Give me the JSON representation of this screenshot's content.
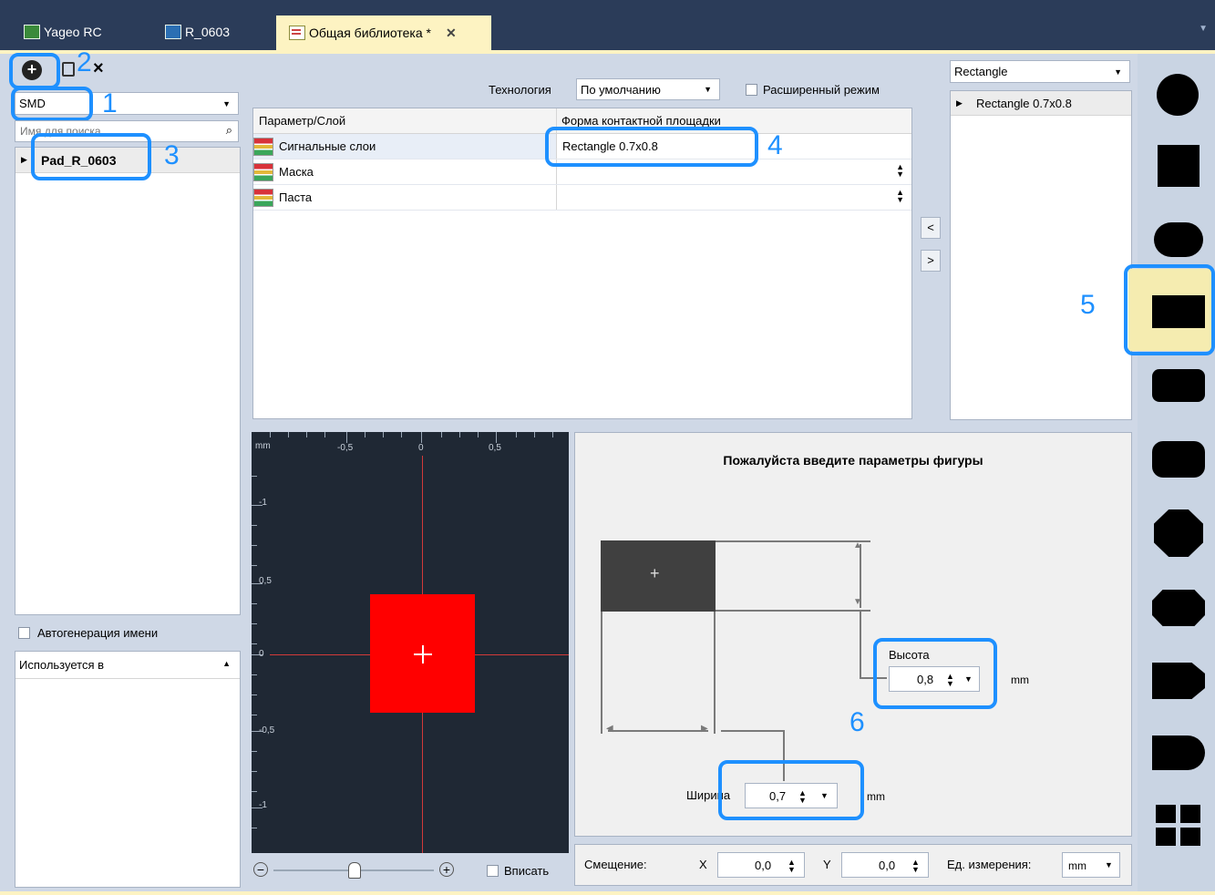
{
  "tabs": [
    {
      "label": "Yageo RC"
    },
    {
      "label": "R_0603"
    },
    {
      "label": "Общая библиотека *"
    }
  ],
  "toolbar": {
    "close_icon": "close-icon",
    "add_icon": "add-circle-icon",
    "copy_icon": "copy-icon"
  },
  "left": {
    "type_select": "SMD",
    "search_placeholder": "Имя для поиска",
    "tree_item": "Pad_R_0603",
    "autogen_label": "Автогенерация имени",
    "used_in_label": "Используется в"
  },
  "annotations": [
    "1",
    "2",
    "3",
    "4",
    "5",
    "6"
  ],
  "center": {
    "technology_label": "Технология",
    "technology_value": "По умолчанию",
    "advanced_label": "Расширенный режим",
    "col_param": "Параметр/Слой",
    "col_shape": "Форма контактной площадки",
    "rows": [
      {
        "layer": "Сигнальные слои",
        "shape": "Rectangle 0.7x0.8"
      },
      {
        "layer": "Маска",
        "shape": ""
      },
      {
        "layer": "Паста",
        "shape": ""
      }
    ],
    "btn_left": "<",
    "btn_right": ">"
  },
  "shape_list": {
    "filter": "Rectangle",
    "item": "Rectangle 0.7x0.8"
  },
  "canvas": {
    "unit": "mm",
    "x_ticks": [
      "-0,5",
      "0",
      "0,5"
    ],
    "y_ticks": [
      "-1",
      "0,5",
      "0",
      "-0,5",
      "-1"
    ],
    "fit_label": "Вписать",
    "pad_color": "#ff0000"
  },
  "params": {
    "title": "Пожалуйста введите параметры фигуры",
    "height_label": "Высота",
    "height_value": "0,8",
    "height_unit": "mm",
    "width_label": "Ширина",
    "width_value": "0,7",
    "width_unit": "mm"
  },
  "offset": {
    "label": "Смещение:",
    "x_label": "X",
    "x_value": "0,0",
    "y_label": "Y",
    "y_value": "0,0",
    "units_label": "Ед. измерения:",
    "units_value": "mm"
  },
  "colors": {
    "accent": "#1e90ff",
    "tab_bg": "#2b3c59",
    "selected": "#f5ecb0"
  }
}
